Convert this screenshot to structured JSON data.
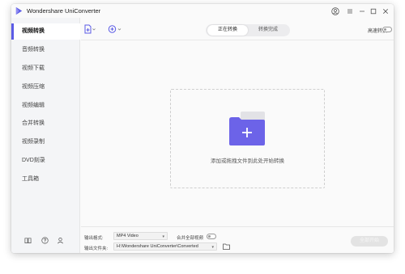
{
  "app": {
    "title": "Wondershare UniConverter",
    "accent_color": "#5b5be6",
    "folder_color": "#6c63e8"
  },
  "titlebar": {
    "icons": [
      "user-icon",
      "menu-icon",
      "minimize-icon",
      "maximize-icon",
      "close-icon"
    ]
  },
  "sidebar": {
    "items": [
      {
        "label": "视频转换",
        "active": true
      },
      {
        "label": "音频转换",
        "active": false
      },
      {
        "label": "视频下载",
        "active": false
      },
      {
        "label": "视频压缩",
        "active": false
      },
      {
        "label": "视频编辑",
        "active": false
      },
      {
        "label": "合并转换",
        "active": false
      },
      {
        "label": "视频录制",
        "active": false
      },
      {
        "label": "DVD刻录",
        "active": false
      },
      {
        "label": "工具箱",
        "active": false
      }
    ],
    "footer_icons": [
      "book-icon",
      "help-icon",
      "account-icon"
    ]
  },
  "toolbar": {
    "add_file_icon": "add-file-icon",
    "add_more_icon": "add-more-icon",
    "tabs": [
      {
        "label": "正在转换",
        "active": true
      },
      {
        "label": "转换完成",
        "active": false
      }
    ],
    "fast_convert_label": "高速转换",
    "fast_convert_on": false
  },
  "dropzone": {
    "text": "添加或拖拽文件到此处开始转换"
  },
  "bottom": {
    "output_format_label": "输出格式:",
    "output_format_value": "MP4 Video",
    "merge_label": "合并全部视频",
    "merge_on": false,
    "output_folder_label": "输出文件夹:",
    "output_folder_value": "H:\\Wondershare UniConverter\\Converted",
    "start_all_label": "全部开始"
  }
}
